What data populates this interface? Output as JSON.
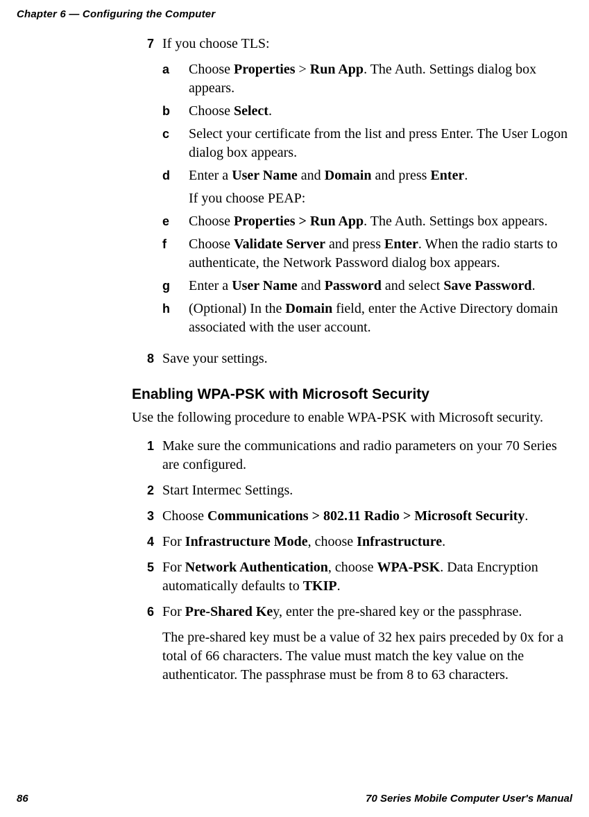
{
  "running_head": "Chapter 6 — Configuring the Computer",
  "footer_left": "86",
  "footer_right": "70 Series Mobile Computer User's Manual",
  "step7": {
    "num": "7",
    "intro": "If you choose TLS:",
    "a": {
      "let": "a",
      "text_pre": "Choose ",
      "b1": "Properties",
      "sep": "  >  ",
      "b2": "Run App",
      "text_post": ". The Auth. Settings dialog box appears."
    },
    "b": {
      "let": "b",
      "text_pre": "Choose ",
      "b1": "Select",
      "text_post": "."
    },
    "c": {
      "let": "c",
      "text": "Select your certificate from the list and press Enter. The User Logon dialog box appears."
    },
    "d": {
      "let": "d",
      "t1": "Enter a ",
      "b1": "User Name",
      "t2": " and ",
      "b2": "Domain",
      "t3": " and press ",
      "b3": "Enter",
      "t4": "."
    },
    "peap_note": "If you choose PEAP:",
    "e": {
      "let": "e",
      "t1": "Choose ",
      "b1": "Properties > Run App",
      "t2": ". The Auth. Settings box appears."
    },
    "f": {
      "let": "f",
      "t1": "Choose ",
      "b1": "Validate Server",
      "t2": " and press ",
      "b2": "Enter",
      "t3": ". When the radio starts to authenticate, the Network Password dialog box appears."
    },
    "g": {
      "let": "g",
      "t1": "Enter a ",
      "b1": "User Name",
      "t2": " and ",
      "b2": "Password",
      "t3": " and select ",
      "b3": "Save Password",
      "t4": "."
    },
    "h": {
      "let": "h",
      "t1": "(Optional) In the ",
      "b1": "Domain",
      "t2": " field, enter the Active Directory domain associated with the user account."
    }
  },
  "step8": {
    "num": "8",
    "text": "Save your settings."
  },
  "section_head": "Enabling WPA-PSK with Microsoft Security",
  "section_intro": "Use the following procedure to enable WPA-PSK with Microsoft security.",
  "wpa": {
    "s1": {
      "num": "1",
      "text": "Make sure the communications and radio parameters on your 70 Series are configured."
    },
    "s2": {
      "num": "2",
      "text": "Start Intermec Settings."
    },
    "s3": {
      "num": "3",
      "t1": "Choose ",
      "b1": "Communications > 802.11 Radio > Microsoft Security",
      "t2": "."
    },
    "s4": {
      "num": "4",
      "t1": "For ",
      "b1": "Infrastructure Mode",
      "t2": ", choose ",
      "b2": "Infrastructure",
      "t3": "."
    },
    "s5": {
      "num": "5",
      "t1": "For ",
      "b1": "Network Authentication",
      "t2": ", choose ",
      "b2": "WPA-PSK",
      "t3": ". Data Encryption automatically defaults to ",
      "b3": "TKIP",
      "t4": "."
    },
    "s6": {
      "num": "6",
      "t1": "For ",
      "b1": "Pre-Shared Ke",
      "t2": "y, enter the pre-shared key or the passphrase."
    },
    "s6_para": "The pre-shared key must be a value of 32 hex pairs preceded by 0x for a total of 66 characters. The value must match the key value on the authenticator. The passphrase must be from 8 to 63 characters."
  }
}
